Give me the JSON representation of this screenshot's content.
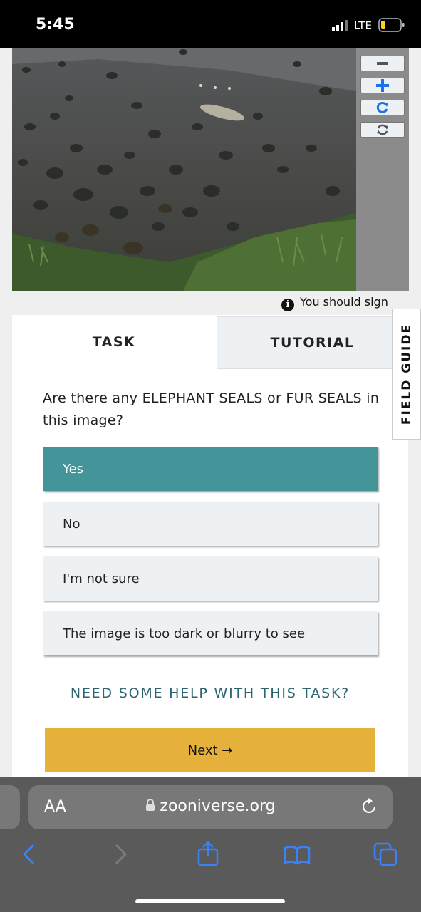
{
  "status_bar": {
    "time": "5:45",
    "network": "LTE"
  },
  "viewer": {
    "notice": "You should sign"
  },
  "tabs": {
    "task": "TASK",
    "tutorial": "TUTORIAL"
  },
  "task": {
    "question": "Are there any ELEPHANT SEALS or FUR SEALS in this image?",
    "answers": [
      {
        "label": "Yes",
        "selected": true
      },
      {
        "label": "No",
        "selected": false
      },
      {
        "label": "I'm not sure",
        "selected": false
      },
      {
        "label": "The image is too dark or blurry to see",
        "selected": false
      }
    ],
    "help_link": "NEED SOME HELP WITH THIS TASK?",
    "next_label": "Next →"
  },
  "field_guide_label": "FIELD GUIDE",
  "browser": {
    "text_size_label": "AA",
    "url": "zooniverse.org"
  },
  "colors": {
    "selected_answer": "#43959a",
    "next_button": "#e6b13a",
    "link": "#2b6370",
    "ios_blue": "#3a82f7"
  },
  "icons": [
    "signal-icon",
    "battery-icon",
    "zoom-out-icon",
    "zoom-in-icon",
    "rotate-icon",
    "reset-icon",
    "info-icon",
    "lock-icon",
    "reload-icon",
    "back-icon",
    "forward-icon",
    "share-icon",
    "bookmarks-icon",
    "tabs-icon"
  ]
}
